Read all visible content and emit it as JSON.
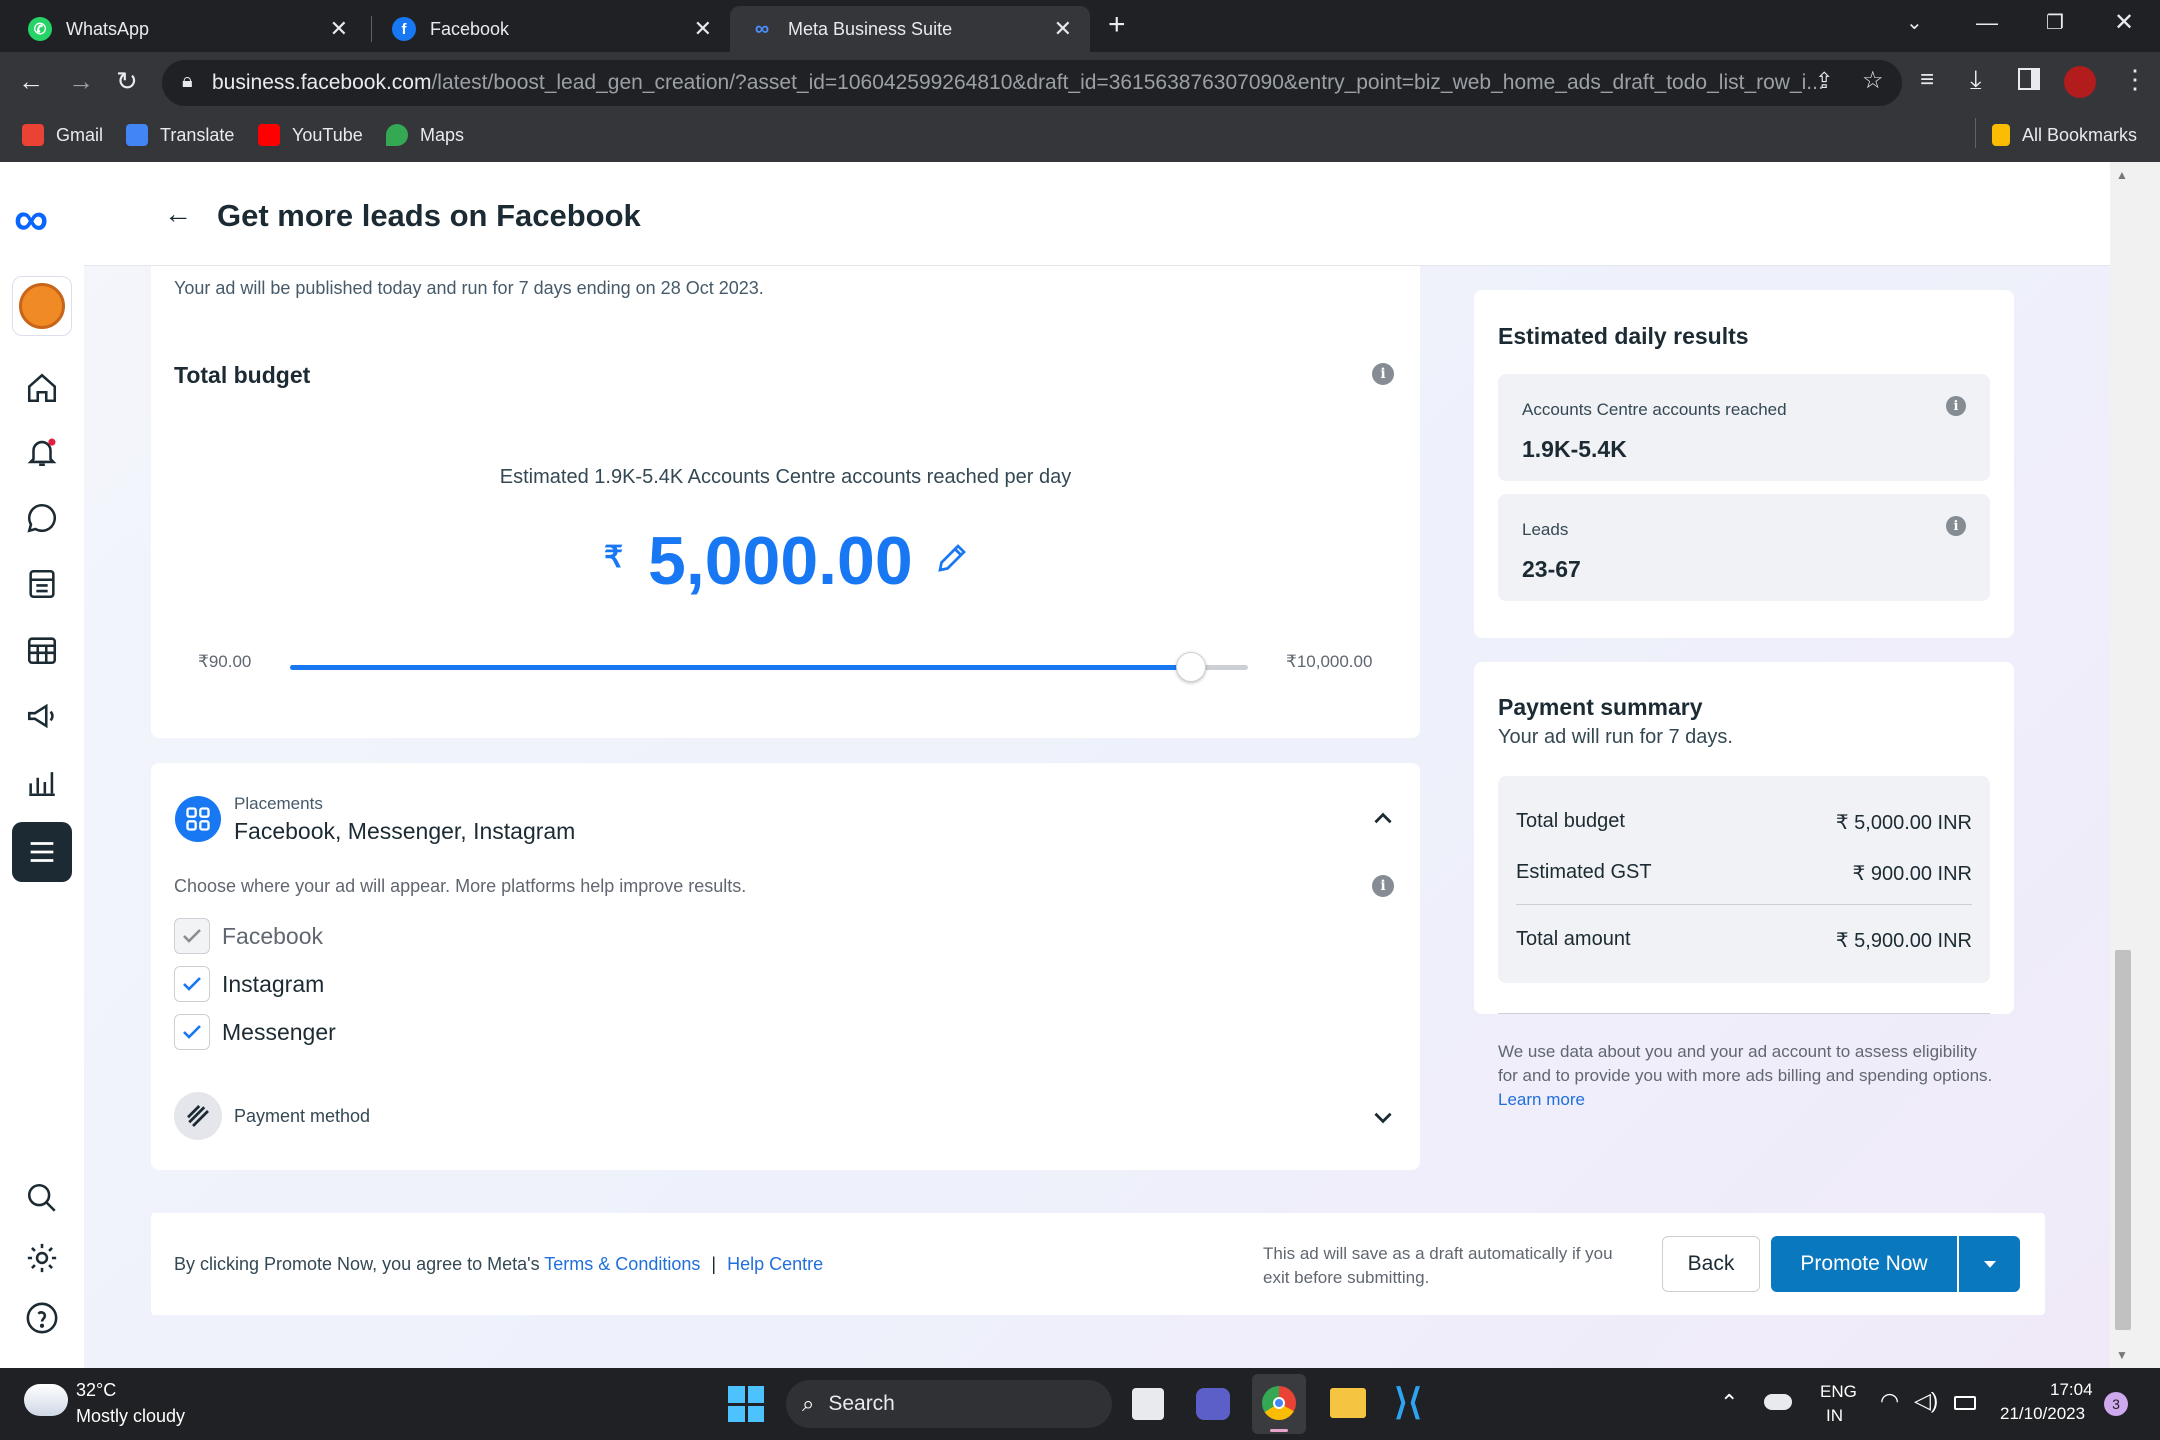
{
  "browser": {
    "tabs": [
      {
        "label": "WhatsApp",
        "icon": "whatsapp-icon",
        "color": "#25d366"
      },
      {
        "label": "Facebook",
        "icon": "facebook-icon",
        "color": "#1877f2"
      },
      {
        "label": "Meta Business Suite",
        "icon": "meta-icon",
        "color": "#0081fb"
      }
    ],
    "url_domain": "business.facebook.com",
    "url_path": "/latest/boost_lead_gen_creation/?asset_id=106042599264810&draft_id=361563876307090&entry_point=biz_web_home_ads_draft_todo_list_row_i...",
    "bookmarks": [
      "Gmail",
      "Translate",
      "YouTube",
      "Maps"
    ],
    "all_bookmarks": "All Bookmarks"
  },
  "header": {
    "title": "Get more leads on Facebook"
  },
  "budget": {
    "publish_note": "Your ad will be published today and run for 7 days ending on 28 Oct 2023.",
    "title": "Total budget",
    "estimate": "Estimated 1.9K-5.4K Accounts Centre accounts reached per day",
    "currency_symbol": "₹",
    "amount": "5,000.00",
    "min_label": "₹90.00",
    "max_label": "₹10,000.00",
    "slider_fraction": 0.94
  },
  "placements": {
    "label": "Placements",
    "value": "Facebook, Messenger, Instagram",
    "hint": "Choose where your ad will appear. More platforms help improve results.",
    "options": [
      {
        "label": "Facebook",
        "checked": true,
        "disabled": true
      },
      {
        "label": "Instagram",
        "checked": true,
        "disabled": false
      },
      {
        "label": "Messenger",
        "checked": true,
        "disabled": false
      }
    ]
  },
  "payment_method": {
    "label": "Payment method"
  },
  "estimated": {
    "title": "Estimated daily results",
    "reach_label": "Accounts Centre accounts reached",
    "reach_value": "1.9K-5.4K",
    "leads_label": "Leads",
    "leads_value": "23-67"
  },
  "summary": {
    "title": "Payment summary",
    "subtitle": "Your ad will run for 7 days.",
    "rows": [
      {
        "label": "Total budget",
        "value": "₹ 5,000.00 INR"
      },
      {
        "label": "Estimated GST",
        "value": "₹ 900.00 INR"
      },
      {
        "label": "Total amount",
        "value": "₹ 5,900.00 INR"
      }
    ],
    "disclaimer": "We use data about you and your ad account to assess eligibility for and to provide you with more ads billing and spending options.",
    "learn_more": "Learn more"
  },
  "footer": {
    "agree_prefix": "By clicking Promote Now, you agree to Meta's",
    "terms": "Terms & Conditions",
    "separator": "|",
    "help": "Help Centre",
    "draft_note_1": "This ad will save as a draft automatically if you",
    "draft_note_2": "exit before submitting.",
    "back": "Back",
    "promote": "Promote Now"
  },
  "taskbar": {
    "temp": "32°C",
    "weather": "Mostly cloudy",
    "search": "Search",
    "lang1": "ENG",
    "lang2": "IN",
    "time": "17:04",
    "date": "21/10/2023",
    "notif": "3"
  },
  "colors": {
    "accent": "#1877f2",
    "primary_button": "#0a78be",
    "link": "#216fdb"
  }
}
